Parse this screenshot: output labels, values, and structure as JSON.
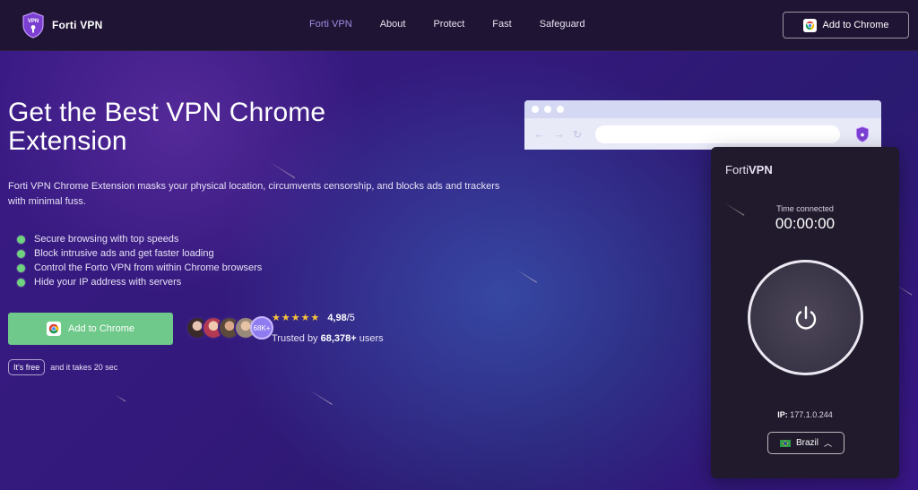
{
  "header": {
    "brand": "Forti VPN",
    "nav": [
      "Forti VPN",
      "About",
      "Protect",
      "Fast",
      "Safeguard"
    ],
    "cta_label": "Add to Chrome"
  },
  "hero": {
    "title": "Get the Best VPN Chrome Extension",
    "description": "Forti VPN Chrome Extension masks your physical location, circumvents censorship, and blocks ads and trackers with minimal fuss.",
    "features": [
      "Secure browsing with top speeds",
      "Block intrusive ads and get faster loading",
      "Control the Forto VPN from within Chrome browsers",
      "Hide your IP address with servers"
    ],
    "cta_label": "Add to Chrome",
    "avatar_count": "68K+",
    "rating_score": "4,98",
    "rating_suffix": "/5",
    "trusted_prefix": "Trusted by ",
    "trusted_count": "68,378+",
    "trusted_suffix": " users",
    "free_pill": "It's free",
    "free_text": "and it takes 20 sec"
  },
  "panel": {
    "brand_light": "Forti",
    "brand_bold": "VPN",
    "time_label": "Time connected",
    "time_value": "00:00:00",
    "ip_label": "IP:",
    "ip_value": "177.1.0.244",
    "country": "Brazil"
  },
  "colors": {
    "accent": "#9e8ee6",
    "cta_green": "#6fc98a",
    "star": "#f7c23b",
    "header_bg": "#1f1433",
    "panel_bg": "#201a2c"
  }
}
